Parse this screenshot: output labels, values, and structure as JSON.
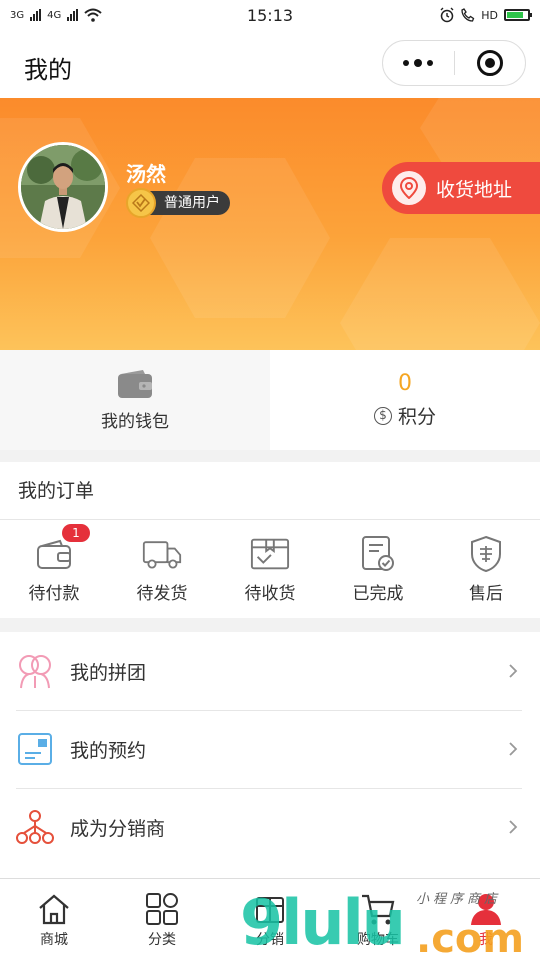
{
  "status_bar": {
    "time": "15:13",
    "network_1": "3G",
    "network_2": "4G",
    "hd": "HD"
  },
  "nav": {
    "title": "我的"
  },
  "profile": {
    "name": "汤然",
    "level": "普通用户",
    "address_button": "收货地址"
  },
  "stats": {
    "wallet_label": "我的钱包",
    "points_value": "0",
    "points_label": "积分",
    "points_symbol": "$"
  },
  "orders": {
    "title": "我的订单",
    "items": [
      {
        "label": "待付款",
        "icon": "wallet-icon",
        "badge": "1"
      },
      {
        "label": "待发货",
        "icon": "truck-icon"
      },
      {
        "label": "待收货",
        "icon": "package-icon"
      },
      {
        "label": "已完成",
        "icon": "completed-doc-icon"
      },
      {
        "label": "售后",
        "icon": "after-sale-shield-icon"
      }
    ]
  },
  "menu": {
    "items": [
      {
        "label": "我的拼团",
        "icon": "group-buy-icon"
      },
      {
        "label": "我的预约",
        "icon": "reservation-card-icon"
      },
      {
        "label": "成为分销商",
        "icon": "distribution-tree-icon"
      }
    ]
  },
  "tabbar": {
    "items": [
      {
        "label": "商城",
        "icon": "home-icon"
      },
      {
        "label": "分类",
        "icon": "category-grid-icon"
      },
      {
        "label": "分销",
        "icon": "distribution-icon"
      },
      {
        "label": "购物车",
        "icon": "cart-icon"
      },
      {
        "label": "我",
        "icon": "user-icon",
        "active": true
      }
    ]
  },
  "watermark": {
    "main": "9lulu",
    "tld": ".com",
    "small": "小程序商店"
  },
  "colors": {
    "accent_red": "#e5303b",
    "banner_orange": "#fb8b2b",
    "points_orange": "#f5a623"
  }
}
